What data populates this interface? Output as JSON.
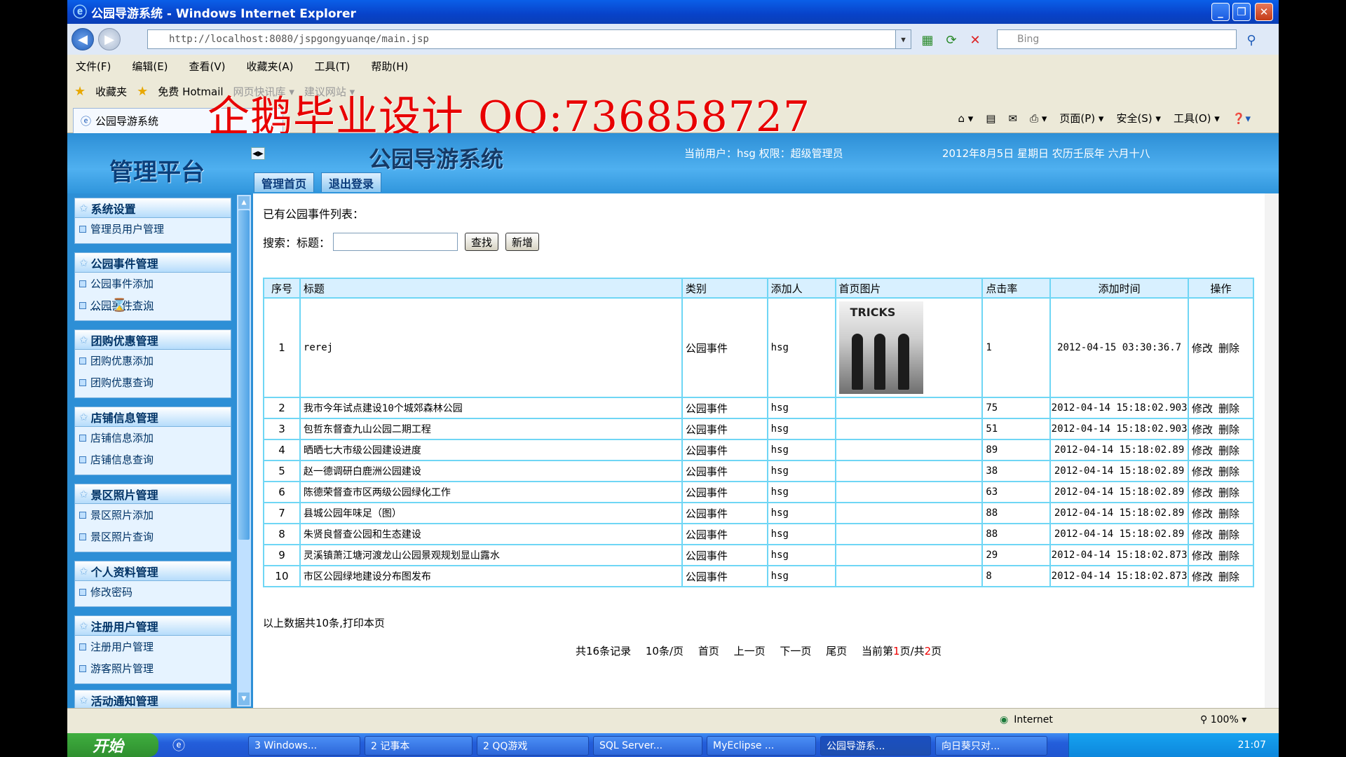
{
  "window": {
    "title": "公园导游系统 - Windows Internet Explorer",
    "min": "_",
    "max": "❐",
    "close": "✕"
  },
  "address": {
    "url": "http://localhost:8080/jspgongyuanqe/main.jsp",
    "search_placeholder": "Bing"
  },
  "menu": [
    "文件(F)",
    "编辑(E)",
    "查看(V)",
    "收藏夹(A)",
    "工具(T)",
    "帮助(H)"
  ],
  "favorites": {
    "label": "收藏夹",
    "items": [
      "免费 Hotmail",
      "网页快讯库 ▾",
      "建议网站 ▾"
    ]
  },
  "tab": {
    "title": "公园导游系统"
  },
  "tabtools": [
    "页面(P) ▾",
    "安全(S) ▾",
    "工具(O) ▾"
  ],
  "watermark": "企鹅毕业设计 QQ:736858727",
  "header": {
    "logo": "管理平台",
    "system_title": "公园导游系统",
    "user_info": "当前用户：hsg 权限：超级管理员",
    "date_info": "2012年8月5日 星期日 农历壬辰年 六月十八",
    "btn_home": "管理首页",
    "btn_logout": "退出登录"
  },
  "sidebar": {
    "groups": [
      {
        "title": "系统设置",
        "items": [
          "管理员用户管理"
        ]
      },
      {
        "title": "公园事件管理",
        "items": [
          "公园事件添加",
          "公园事件查询"
        ]
      },
      {
        "title": "团购优惠管理",
        "items": [
          "团购优惠添加",
          "团购优惠查询"
        ]
      },
      {
        "title": "店铺信息管理",
        "items": [
          "店铺信息添加",
          "店铺信息查询"
        ]
      },
      {
        "title": "景区照片管理",
        "items": [
          "景区照片添加",
          "景区照片查询"
        ]
      },
      {
        "title": "个人资料管理",
        "items": [
          "修改密码"
        ]
      },
      {
        "title": "注册用户管理",
        "items": [
          "注册用户管理",
          "游客照片管理"
        ]
      },
      {
        "title": "活动通知管理",
        "items": []
      }
    ]
  },
  "content": {
    "list_title": "已有公园事件列表：",
    "search_label": "搜索：标题：",
    "search_value": "",
    "btn_search": "查找",
    "btn_add": "新增",
    "columns": [
      "序号",
      "标题",
      "类别",
      "添加人",
      "首页图片",
      "点击率",
      "添加时间",
      "操作"
    ],
    "rows": [
      {
        "no": "1",
        "title": "rerej",
        "type": "公园事件",
        "user": "hsg",
        "img": "TRICKS",
        "clicks": "1",
        "time": "2012-04-15 03:30:36.7"
      },
      {
        "no": "2",
        "title": "我市今年试点建设10个城郊森林公园",
        "type": "公园事件",
        "user": "hsg",
        "img": "",
        "clicks": "75",
        "time": "2012-04-14 15:18:02.903"
      },
      {
        "no": "3",
        "title": "包哲东督查九山公园二期工程",
        "type": "公园事件",
        "user": "hsg",
        "img": "",
        "clicks": "51",
        "time": "2012-04-14 15:18:02.903"
      },
      {
        "no": "4",
        "title": "晒晒七大市级公园建设进度",
        "type": "公园事件",
        "user": "hsg",
        "img": "",
        "clicks": "89",
        "time": "2012-04-14 15:18:02.89"
      },
      {
        "no": "5",
        "title": "赵一德调研白鹿洲公园建设",
        "type": "公园事件",
        "user": "hsg",
        "img": "",
        "clicks": "38",
        "time": "2012-04-14 15:18:02.89"
      },
      {
        "no": "6",
        "title": "陈德荣督查市区两级公园绿化工作",
        "type": "公园事件",
        "user": "hsg",
        "img": "",
        "clicks": "63",
        "time": "2012-04-14 15:18:02.89"
      },
      {
        "no": "7",
        "title": "县城公园年味足（图）",
        "type": "公园事件",
        "user": "hsg",
        "img": "",
        "clicks": "88",
        "time": "2012-04-14 15:18:02.89"
      },
      {
        "no": "8",
        "title": "朱贤良督查公园和生态建设",
        "type": "公园事件",
        "user": "hsg",
        "img": "",
        "clicks": "88",
        "time": "2012-04-14 15:18:02.89"
      },
      {
        "no": "9",
        "title": "灵溪镇萧江塘河渡龙山公园景观规划显山露水",
        "type": "公园事件",
        "user": "hsg",
        "img": "",
        "clicks": "29",
        "time": "2012-04-14 15:18:02.873"
      },
      {
        "no": "10",
        "title": "市区公园绿地建设分布图发布",
        "type": "公园事件",
        "user": "hsg",
        "img": "",
        "clicks": "8",
        "time": "2012-04-14 15:18:02.873"
      }
    ],
    "op_edit": "修改",
    "op_delete": "删除",
    "footnote": "以上数据共10条,打印本页",
    "pager": {
      "total": "共16条记录",
      "per_page": "10条/页",
      "first": "首页",
      "prev": "上一页",
      "next": "下一页",
      "last": "尾页",
      "current_prefix": "当前第",
      "current": "1",
      "mid": "页/共",
      "pages": "2",
      "suffix": "页"
    }
  },
  "status": {
    "zone": "Internet",
    "zoom": "100%"
  },
  "taskbar": {
    "start": "开始",
    "tasks": [
      "3 Windows...",
      "2 记事本",
      "2 QQ游戏",
      "SQL Server...",
      "MyEclipse ...",
      "公园导游系...",
      "向日葵只对..."
    ],
    "clock": "21:07"
  },
  "colors": {
    "header_blue": "#2d8fd6",
    "table_border": "#6fd6f5",
    "watermark_red": "#e80000"
  }
}
